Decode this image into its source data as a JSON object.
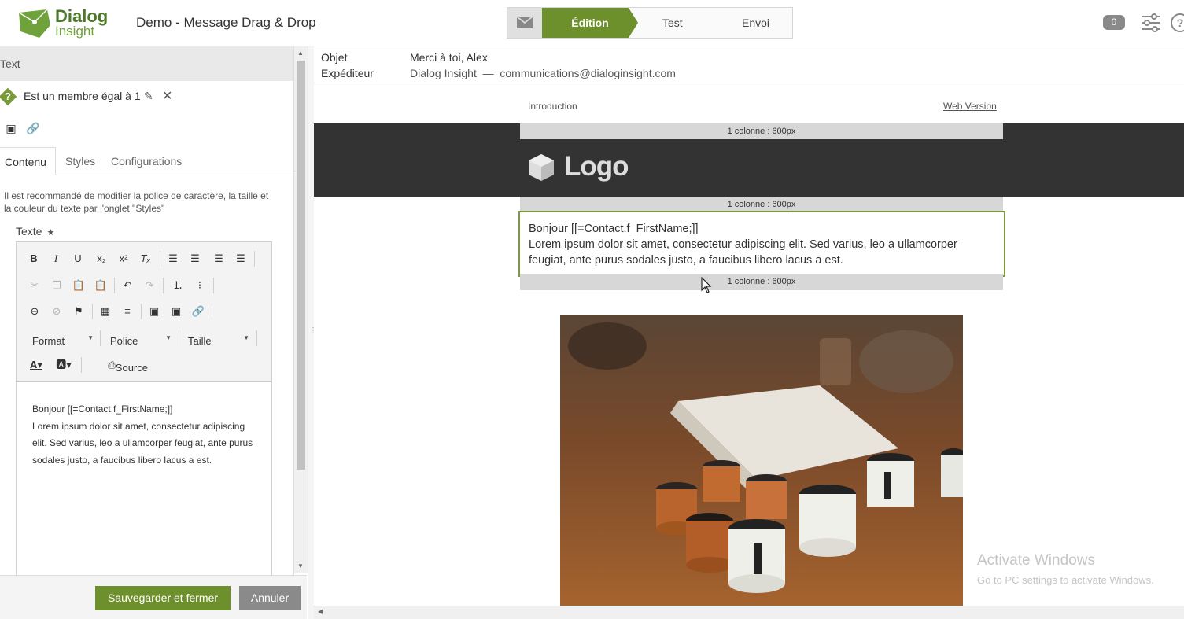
{
  "header": {
    "brand_line1": "Dialog",
    "brand_line2": "Insight",
    "doc_title": "Demo - Message Drag & Drop",
    "steps": [
      "Édition",
      "Test",
      "Envoi"
    ],
    "notification_count": "0",
    "accent_color": "#6d8f2c"
  },
  "panel": {
    "title": "Text",
    "condition": "Est un membre égal à 1",
    "tabs": [
      "Contenu",
      "Styles",
      "Configurations"
    ],
    "active_tab": "Contenu",
    "hint": "Il est recommandé de modifier la police de caractère, la taille et la couleur du texte par l'onglet \"Styles\"",
    "field_label": "Texte",
    "toolbar": {
      "format": "Format",
      "font": "Police",
      "size": "Taille",
      "source": "Source"
    },
    "editor_line1": "Bonjour [[=Contact.f_FirstName;]]",
    "editor_body": "Lorem ipsum dolor sit amet, consectetur adipiscing elit. Sed varius, leo a ullamcorper feugiat, ante purus sodales justo, a faucibus libero lacus a est.",
    "save_label": "Sauvegarder et fermer",
    "cancel_label": "Annuler"
  },
  "message": {
    "subject_label": "Objet",
    "subject": "Merci à toi, Alex",
    "sender_label": "Expéditeur",
    "sender": "Dialog Insight  —  communications@dialoginsight.com"
  },
  "preview": {
    "intro": "Introduction",
    "web_version": "Web Version",
    "column_label": "1 colonne : 600px",
    "logo_text": "Logo",
    "greeting": "Bonjour [[=Contact.f_FirstName;]]",
    "body_pre": "Lorem ",
    "body_link": "ipsum dolor sit amet",
    "body_post": ", consectetur adipiscing elit. Sed varius, leo a ullamcorper feugiat, ante purus sodales justo, a faucibus libero lacus a est."
  },
  "watermark": {
    "line1": "Activate Windows",
    "line2": "Go to PC settings to activate Windows."
  }
}
